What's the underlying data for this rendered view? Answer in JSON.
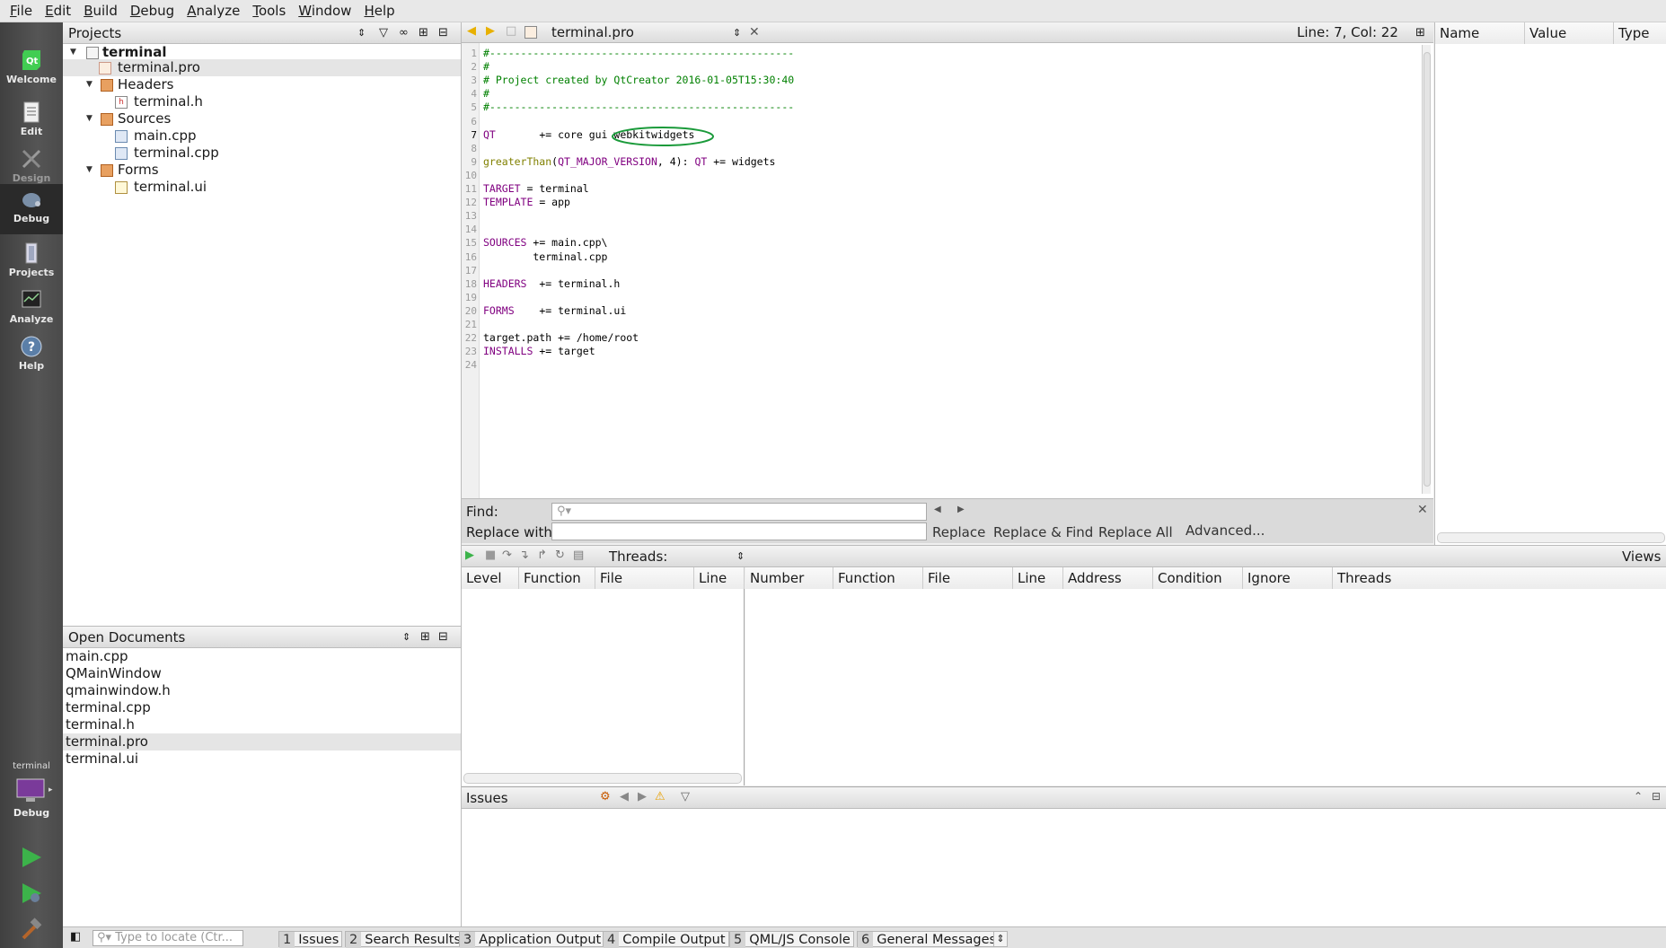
{
  "menu": [
    "File",
    "Edit",
    "Build",
    "Debug",
    "Analyze",
    "Tools",
    "Window",
    "Help"
  ],
  "modes": [
    {
      "label": "Welcome",
      "icon": "qt-logo-icon"
    },
    {
      "label": "Edit",
      "icon": "document-icon"
    },
    {
      "label": "Design",
      "icon": "design-tools-icon"
    },
    {
      "label": "Debug",
      "icon": "bug-icon"
    },
    {
      "label": "Projects",
      "icon": "projects-wrench-icon"
    },
    {
      "label": "Analyze",
      "icon": "analyze-monitor-icon"
    },
    {
      "label": "Help",
      "icon": "help-icon"
    }
  ],
  "kit": {
    "project": "terminal",
    "config": "Debug"
  },
  "projects": {
    "title": "Projects",
    "tree": [
      {
        "label": "terminal",
        "bold": true
      },
      {
        "label": "terminal.pro"
      },
      {
        "label": "Headers"
      },
      {
        "label": "terminal.h"
      },
      {
        "label": "Sources"
      },
      {
        "label": "main.cpp"
      },
      {
        "label": "terminal.cpp"
      },
      {
        "label": "Forms"
      },
      {
        "label": "terminal.ui"
      }
    ]
  },
  "open_documents": {
    "title": "Open Documents",
    "items": [
      "main.cpp",
      "QMainWindow",
      "qmainwindow.h",
      "terminal.cpp",
      "terminal.h",
      "terminal.pro",
      "terminal.ui"
    ]
  },
  "editor": {
    "file": "terminal.pro",
    "position": "Line: 7, Col: 22",
    "lines": [
      "#-------------------------------------------------",
      "#",
      "# Project created by QtCreator 2016-01-05T15:30:40",
      "#",
      "#-------------------------------------------------",
      "",
      "QT       += core gui webkitwidgets",
      "",
      "greaterThan(QT_MAJOR_VERSION, 4): QT += widgets",
      "",
      "TARGET = terminal",
      "TEMPLATE = app",
      "",
      "",
      "SOURCES += main.cpp\\",
      "        terminal.cpp",
      "",
      "HEADERS  += terminal.h",
      "",
      "FORMS    += terminal.ui",
      "",
      "target.path += /home/root",
      "INSTALLS += target",
      ""
    ]
  },
  "find": {
    "find_label": "Find:",
    "replace_label": "Replace with:",
    "replace": "Replace",
    "replace_find": "Replace & Find",
    "replace_all": "Replace All",
    "advanced": "Advanced..."
  },
  "locals": {
    "columns": [
      "Name",
      "Value",
      "Type"
    ]
  },
  "debug": {
    "threads_label": "Threads:",
    "views": "Views",
    "stack_columns": [
      "Level",
      "Function",
      "File",
      "Line"
    ],
    "breakpoint_columns": [
      "Number",
      "Function",
      "File",
      "Line",
      "Address",
      "Condition",
      "Ignore",
      "Threads"
    ]
  },
  "issues": {
    "title": "Issues"
  },
  "status": {
    "locate_placeholder": "Type to locate (Ctr...",
    "tabs": [
      {
        "num": "1",
        "label": "Issues"
      },
      {
        "num": "2",
        "label": "Search Results"
      },
      {
        "num": "3",
        "label": "Application Output"
      },
      {
        "num": "4",
        "label": "Compile Output"
      },
      {
        "num": "5",
        "label": "QML/JS Console"
      },
      {
        "num": "6",
        "label": "General Messages"
      }
    ]
  },
  "colors": {
    "comment": "#008000",
    "keyword": "#800080",
    "function": "#808000",
    "highlight_circle": "#1a9a3a"
  }
}
